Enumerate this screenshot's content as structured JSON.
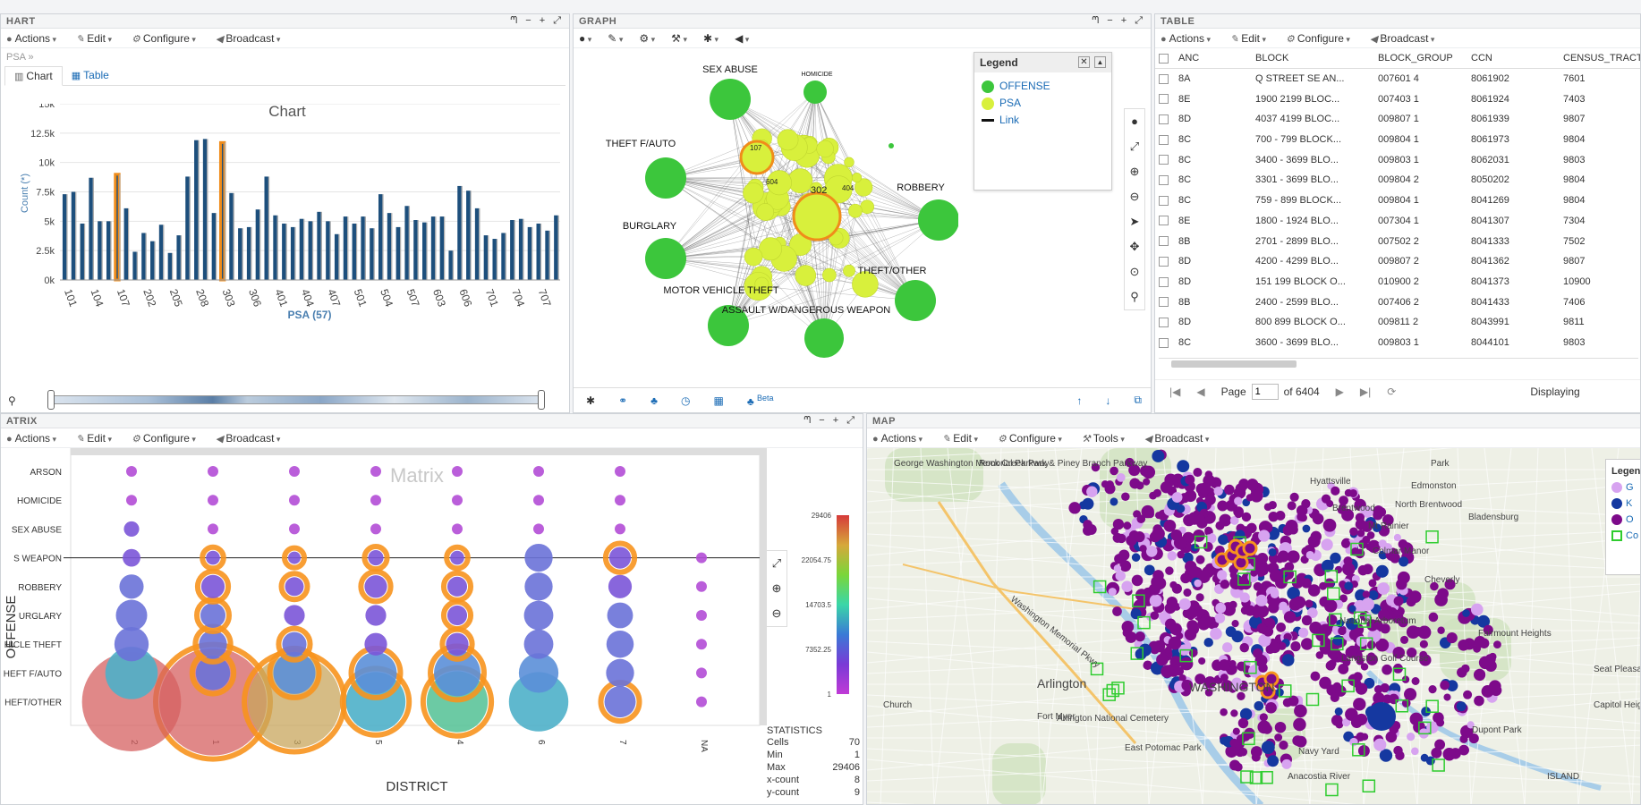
{
  "chart_panel": {
    "title": "HART",
    "controls": "ᘉ − + ⤢",
    "toolbar": [
      "Actions",
      "Edit",
      "Configure",
      "Broadcast"
    ],
    "breadcrumb": "PSA »",
    "tabs": [
      "Chart",
      "Table"
    ],
    "chart_title": "Chart",
    "xlabel": "PSA (57)",
    "ylabel": "Count (*)"
  },
  "graph_panel": {
    "title": "GRAPH",
    "controls": "ᘉ − + ⤢",
    "legend": {
      "title": "Legend",
      "items": [
        {
          "label": "OFFENSE",
          "color": "#3cc63c"
        },
        {
          "label": "PSA",
          "color": "#d8f03c"
        },
        {
          "label": "Link",
          "color": "#111111"
        }
      ]
    },
    "nodes": [
      {
        "label": "SEX ABUSE"
      },
      {
        "label": "HOMICIDE"
      },
      {
        "label": "THEFT F/AUTO"
      },
      {
        "label": "ROBBERY"
      },
      {
        "label": "BURGLARY"
      },
      {
        "label": "THEFT/OTHER"
      },
      {
        "label": "MOTOR VEHICLE THEFT"
      },
      {
        "label": "ASSAULT W/DANGEROUS WEAPON"
      }
    ],
    "psa_labels": [
      "302",
      "107",
      "604",
      "404"
    ],
    "bottom_beta": "Beta"
  },
  "table_panel": {
    "title": "TABLE",
    "toolbar": [
      "Actions",
      "Edit",
      "Configure",
      "Broadcast"
    ],
    "columns": [
      "ANC",
      "BLOCK",
      "BLOCK_GROUP",
      "CCN",
      "CENSUS_TRACT"
    ],
    "rows": [
      [
        "8A",
        "Q STREET SE AN...",
        "007601 4",
        "8061902",
        "7601"
      ],
      [
        "8E",
        "1900 2199 BLOC...",
        "007403 1",
        "8061924",
        "7403"
      ],
      [
        "8D",
        "4037 4199 BLOC...",
        "009807 1",
        "8061939",
        "9807"
      ],
      [
        "8C",
        "700 - 799 BLOCK...",
        "009804 1",
        "8061973",
        "9804"
      ],
      [
        "8C",
        "3400 - 3699 BLO...",
        "009803 1",
        "8062031",
        "9803"
      ],
      [
        "8C",
        "3301 - 3699 BLO...",
        "009804 2",
        "8050202",
        "9804"
      ],
      [
        "8C",
        "759 - 899 BLOCK...",
        "009804 1",
        "8041269",
        "9804"
      ],
      [
        "8E",
        "1800 - 1924 BLO...",
        "007304 1",
        "8041307",
        "7304"
      ],
      [
        "8B",
        "2701 - 2899 BLO...",
        "007502 2",
        "8041333",
        "7502"
      ],
      [
        "8D",
        "4200 - 4299 BLO...",
        "009807 2",
        "8041362",
        "9807"
      ],
      [
        "8D",
        "151 199 BLOCK O...",
        "010900 2",
        "8041373",
        "10900"
      ],
      [
        "8B",
        "2400 - 2599 BLO...",
        "007406 2",
        "8041433",
        "7406"
      ],
      [
        "8D",
        "800 899 BLOCK O...",
        "009811 2",
        "8043991",
        "9811"
      ],
      [
        "8C",
        "3600 - 3699 BLO...",
        "009803 1",
        "8044101",
        "9803"
      ]
    ],
    "pager": {
      "page_label": "Page",
      "page_value": "1",
      "of_label": "of 6404",
      "displaying": "Displaying"
    }
  },
  "matrix_panel": {
    "title": "ATRIX",
    "toolbar": [
      "Actions",
      "Edit",
      "Configure",
      "Broadcast"
    ],
    "watermark": "Matrix",
    "ylabel": "OFFENSE",
    "xlabel": "DISTRICT",
    "rows": [
      "ARSON",
      "HOMICIDE",
      "SEX ABUSE",
      "S WEAPON",
      "ROBBERY",
      "URGLARY",
      "HICLE THEFT",
      "HEFT F/AUTO",
      "HEFT/OTHER"
    ],
    "cols": [
      "2",
      "1",
      "3",
      "5",
      "4",
      "6",
      "7",
      "NA"
    ],
    "colorbar": [
      "29406",
      "22054.75",
      "14703.5",
      "7352.25",
      "1"
    ],
    "stats_title": "STATISTICS",
    "stats": [
      [
        "Cells",
        "70"
      ],
      [
        "Min",
        "1"
      ],
      [
        "Max",
        "29406"
      ],
      [
        "x-count",
        "8"
      ],
      [
        "y-count",
        "9"
      ]
    ]
  },
  "map_panel": {
    "title": "MAP",
    "toolbar": [
      "Actions",
      "Edit",
      "Configure",
      "Tools",
      "Broadcast"
    ],
    "places": [
      "George Washington Memorial Parkway",
      "Rock Creek Park & Piney Branch Parkway",
      "Hyattsville",
      "Edmonston",
      "North Brentwood",
      "Brentwood",
      "Bladensburg",
      "Mt Rainier",
      "Colmar Manor",
      "Cheverly",
      "Fairmount Heights",
      "Seat Pleasant",
      "Capitol Heights",
      "Arlington",
      "Fort Myer",
      "Arlington National Cemetery",
      "East Potomac Park",
      "Church",
      "WASHINGTON",
      "National Arboretum",
      "Langston Golf Course",
      "Navy Yard",
      "Dupont Park",
      "Washington Memorial Pkwy",
      "Park",
      "Anacostia River",
      "ISLAND"
    ],
    "legend_title": "Legen",
    "legend_items": [
      "G",
      "K",
      "O",
      "Co"
    ]
  },
  "chart_data": {
    "type": "bar",
    "xlabel": "PSA (57)",
    "ylabel": "Count (*)",
    "title": "Chart",
    "ylim": [
      0,
      15000
    ],
    "yticks": [
      "0k",
      "2.5k",
      "5k",
      "7.5k",
      "10k",
      "12.5k",
      "15k"
    ],
    "xticks": [
      "101",
      "104",
      "107",
      "202",
      "205",
      "208",
      "303",
      "306",
      "401",
      "404",
      "407",
      "501",
      "504",
      "507",
      "603",
      "606",
      "701",
      "704",
      "707"
    ],
    "values": [
      7300,
      7500,
      4800,
      8700,
      5000,
      5000,
      9000,
      6100,
      2400,
      4000,
      3300,
      4700,
      2300,
      3800,
      8800,
      11900,
      12000,
      5700,
      11700,
      7400,
      4400,
      4500,
      6000,
      8800,
      5500,
      4800,
      4500,
      5200,
      5000,
      5800,
      5000,
      3900,
      5400,
      4800,
      5400,
      4400,
      7300,
      5700,
      4500,
      6300,
      5100,
      4900,
      5400,
      5400,
      2500,
      8000,
      7600,
      6100,
      3800,
      3500,
      4000,
      5100,
      5200,
      4500,
      4800,
      4200,
      5500
    ],
    "highlight": [
      6,
      18
    ]
  },
  "matrix_data": {
    "type": "heatmap",
    "cells": [
      [
        1,
        0,
        150,
        1,
        0
      ],
      [
        1,
        1,
        150,
        1,
        0
      ],
      [
        1,
        2,
        250,
        1,
        0
      ],
      [
        1,
        3,
        500,
        1,
        1
      ],
      [
        1,
        4,
        1400,
        1,
        1
      ],
      [
        1,
        5,
        1600,
        1,
        1
      ],
      [
        1,
        6,
        2000,
        1,
        1
      ],
      [
        1,
        7,
        3000,
        1,
        1
      ],
      [
        1,
        8,
        29406,
        0,
        1
      ],
      [
        2,
        0,
        150,
        1,
        0
      ],
      [
        2,
        1,
        150,
        1,
        0
      ],
      [
        2,
        2,
        200,
        1,
        0
      ],
      [
        2,
        3,
        400,
        1,
        1
      ],
      [
        2,
        4,
        900,
        1,
        1
      ],
      [
        2,
        5,
        1100,
        1,
        0
      ],
      [
        2,
        6,
        1500,
        1,
        1
      ],
      [
        2,
        7,
        4500,
        1,
        1
      ],
      [
        2,
        8,
        22000,
        1,
        1
      ],
      [
        0,
        0,
        200,
        1,
        0
      ],
      [
        0,
        1,
        150,
        1,
        0
      ],
      [
        0,
        2,
        600,
        1,
        0
      ],
      [
        0,
        3,
        800,
        1,
        0
      ],
      [
        0,
        4,
        1500,
        1,
        0
      ],
      [
        0,
        5,
        2500,
        1,
        0
      ],
      [
        0,
        6,
        3000,
        1,
        0
      ],
      [
        0,
        7,
        7000,
        1,
        0
      ],
      [
        0,
        8,
        25000,
        1,
        0
      ],
      [
        3,
        0,
        150,
        1,
        0
      ],
      [
        3,
        1,
        150,
        1,
        0
      ],
      [
        3,
        2,
        250,
        1,
        0
      ],
      [
        3,
        3,
        600,
        1,
        1
      ],
      [
        3,
        4,
        1300,
        1,
        1
      ],
      [
        3,
        5,
        1100,
        1,
        0
      ],
      [
        3,
        6,
        1300,
        1,
        0
      ],
      [
        3,
        7,
        4500,
        1,
        1
      ],
      [
        3,
        8,
        9000,
        1,
        1
      ],
      [
        4,
        0,
        150,
        1,
        0
      ],
      [
        4,
        1,
        150,
        1,
        0
      ],
      [
        4,
        2,
        200,
        1,
        0
      ],
      [
        4,
        3,
        500,
        1,
        1
      ],
      [
        4,
        4,
        1000,
        1,
        1
      ],
      [
        4,
        5,
        1000,
        1,
        1
      ],
      [
        4,
        6,
        1300,
        1,
        1
      ],
      [
        4,
        7,
        5500,
        1,
        1
      ],
      [
        4,
        8,
        9500,
        1,
        1
      ],
      [
        5,
        0,
        150,
        1,
        0
      ],
      [
        5,
        1,
        150,
        1,
        0
      ],
      [
        5,
        2,
        250,
        1,
        0
      ],
      [
        5,
        3,
        2000,
        1,
        0
      ],
      [
        5,
        4,
        2000,
        1,
        0
      ],
      [
        5,
        5,
        2200,
        1,
        0
      ],
      [
        5,
        6,
        2200,
        1,
        0
      ],
      [
        5,
        7,
        4000,
        1,
        0
      ],
      [
        5,
        8,
        9000,
        1,
        0
      ],
      [
        6,
        0,
        150,
        1,
        0
      ],
      [
        6,
        1,
        150,
        1,
        0
      ],
      [
        6,
        2,
        200,
        1,
        0
      ],
      [
        6,
        3,
        1200,
        1,
        1
      ],
      [
        6,
        4,
        1400,
        1,
        0
      ],
      [
        6,
        5,
        1700,
        1,
        0
      ],
      [
        6,
        6,
        1900,
        1,
        0
      ],
      [
        6,
        7,
        2000,
        1,
        0
      ],
      [
        6,
        8,
        2500,
        1,
        1
      ],
      [
        7,
        3,
        60,
        1,
        0
      ],
      [
        7,
        4,
        60,
        1,
        0
      ],
      [
        7,
        5,
        60,
        1,
        0
      ],
      [
        7,
        6,
        60,
        1,
        0
      ],
      [
        7,
        7,
        60,
        1,
        0
      ],
      [
        7,
        8,
        60,
        1,
        0
      ]
    ]
  }
}
